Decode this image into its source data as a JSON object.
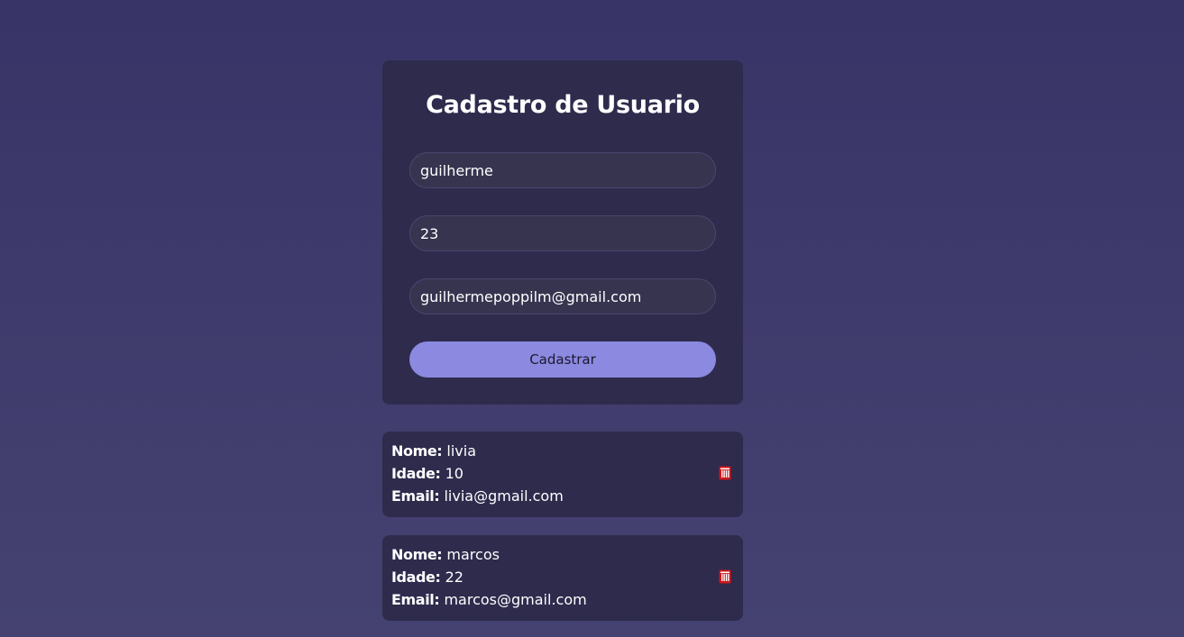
{
  "form": {
    "title": "Cadastro de Usuario",
    "name_value": "guilherme",
    "age_value": "23",
    "email_value": "guilhermepoppilm@gmail.com",
    "submit_label": "Cadastrar"
  },
  "users": [
    {
      "name_label": "Nome:",
      "name": "livia",
      "age_label": "Idade:",
      "age": "10",
      "email_label": "Email:",
      "email": "livia@gmail.com",
      "delete_icon": "trash-icon"
    },
    {
      "name_label": "Nome:",
      "name": "marcos",
      "age_label": "Idade:",
      "age": "22",
      "email_label": "Email:",
      "email": "marcos@gmail.com",
      "delete_icon": "trash-icon"
    }
  ],
  "colors": {
    "background": "#3d396b",
    "card": "#2e2b4d",
    "input_bg": "#36344f",
    "button": "#8b89e0",
    "delete": "#d0161a"
  }
}
